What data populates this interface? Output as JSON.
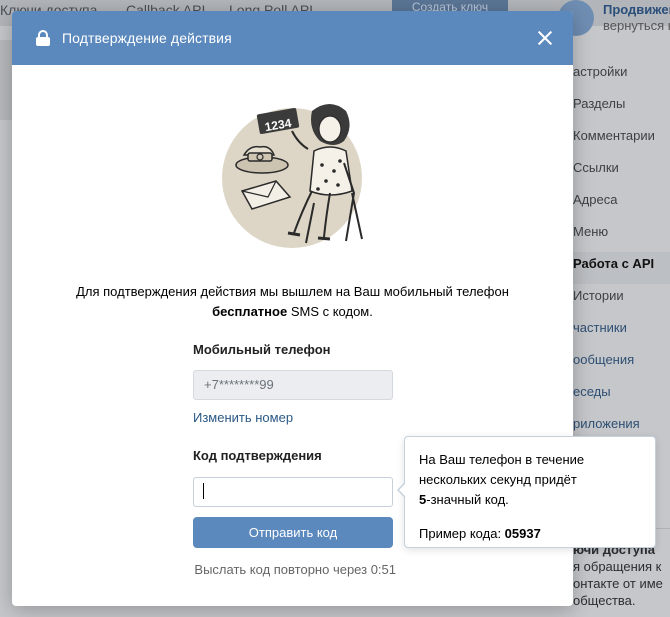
{
  "background": {
    "tabs": [
      "Ключи доступа",
      "Callback API",
      "Long Poll API"
    ],
    "create_button": "Создать ключ",
    "header_title": "Продвижен",
    "header_subtitle": "вернуться к",
    "menu": [
      {
        "label": "астройки",
        "active": false
      },
      {
        "label": "Разделы",
        "active": false
      },
      {
        "label": "Комментарии",
        "active": false
      },
      {
        "label": "Ссылки",
        "active": false
      },
      {
        "label": "Адреса",
        "active": false
      },
      {
        "label": "Меню",
        "active": false
      },
      {
        "label": "Работа с API",
        "active": true
      },
      {
        "label": "Истории",
        "active": false
      },
      {
        "label": "частники",
        "active": false
      },
      {
        "label": "ообщения",
        "active": false
      },
      {
        "label": "еседы",
        "active": false
      },
      {
        "label": "риложения",
        "active": false
      }
    ],
    "bottom_title": "ючи доступа",
    "bottom_lines": [
      "я обращения к",
      "онтакте от име",
      "общества."
    ]
  },
  "modal": {
    "title": "Подтверждение действия",
    "illustration_number": "1234",
    "desc_line1": "Для подтверждения действия мы вышлем на Ваш мобильный телефон",
    "desc_bold": "бесплатное",
    "desc_rest": " SMS с кодом.",
    "phone_label": "Мобильный телефон",
    "phone_value": "+7********99",
    "change_link": "Изменить номер",
    "code_label": "Код подтверждения",
    "code_value": "",
    "send_button": "Отправить код",
    "resend_text": "Выслать код повторно через 0:51"
  },
  "tooltip": {
    "line1": "На Ваш телефон в течение",
    "line2": "нескольких секунд придёт",
    "line3_bold": "5",
    "line3_rest": "-значный код.",
    "example_label": "Пример кода: ",
    "example_code": "05937"
  },
  "colors": {
    "accent": "#5b88bd",
    "link": "#2a5885"
  }
}
